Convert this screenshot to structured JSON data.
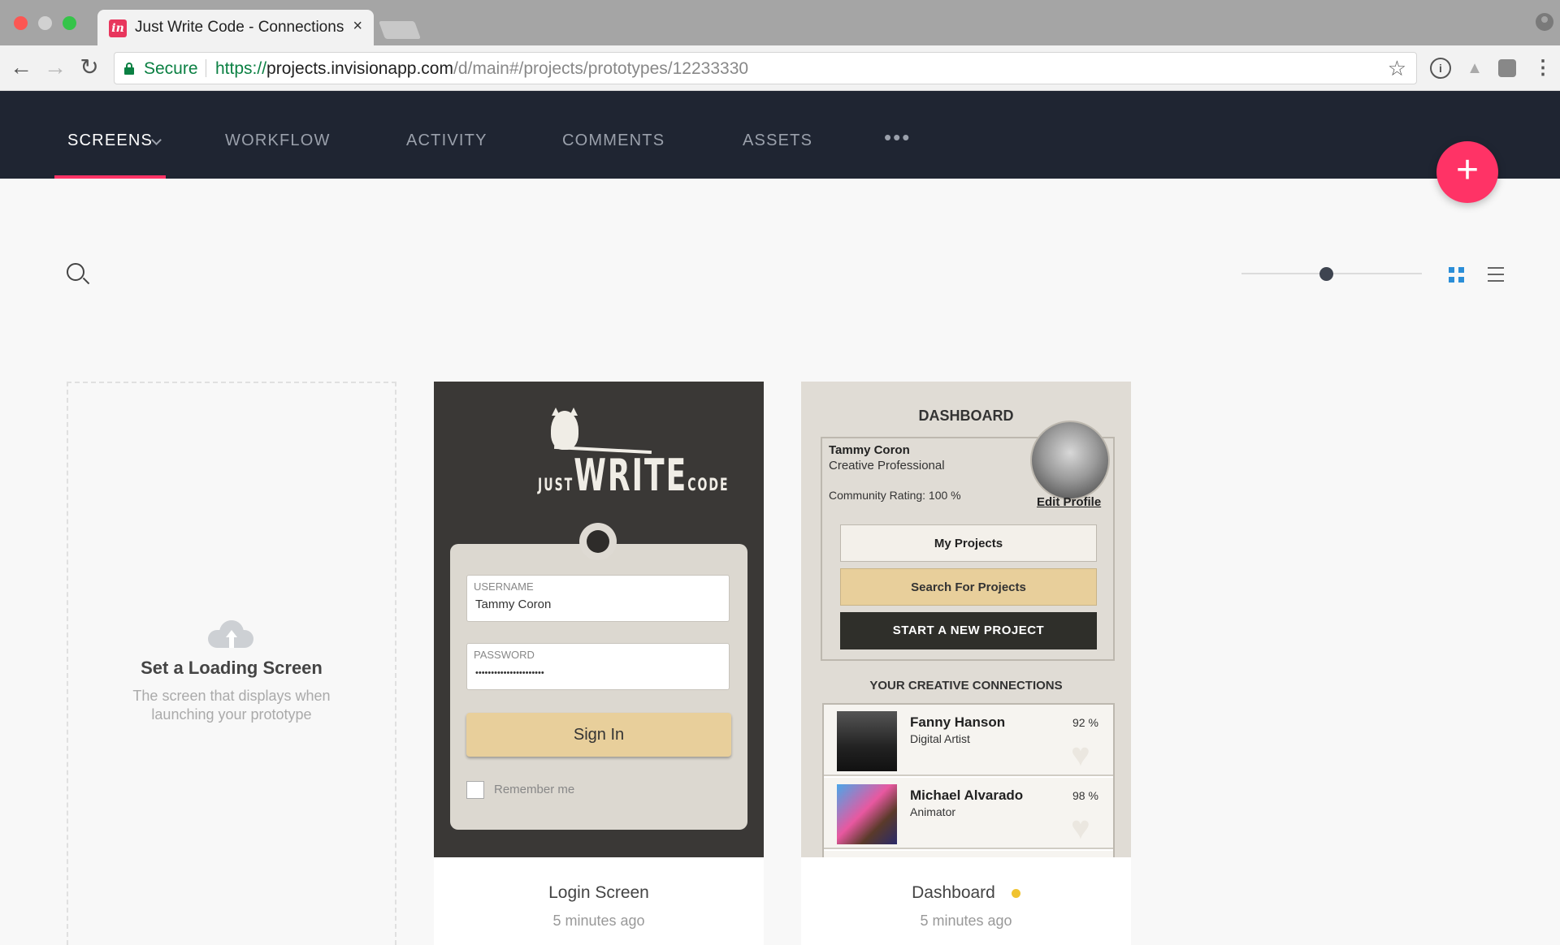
{
  "browser": {
    "tab_title": "Just Write Code - Connections",
    "tab_close": "×",
    "favicon": "in",
    "secure_label": "Secure",
    "url_protocol": "https://",
    "url_host": "projects.invisionapp.com",
    "url_path": "/d/main#/projects/prototypes/12233330"
  },
  "nav": {
    "tabs": [
      {
        "label": "SCREENS",
        "active": true
      },
      {
        "label": "WORKFLOW"
      },
      {
        "label": "ACTIVITY"
      },
      {
        "label": "COMMENTS"
      },
      {
        "label": "ASSETS"
      }
    ],
    "more": "•••",
    "add": "+"
  },
  "accent": "#ff3366",
  "loading_card": {
    "title": "Set a Loading Screen",
    "subtitle": "The screen that displays when launching your prototype"
  },
  "cards": [
    {
      "title": "Login Screen",
      "time": "5 minutes ago",
      "login": {
        "logo_just": "JUST",
        "logo_write": "WRITE",
        "logo_code": "CODE",
        "username_label": "USERNAME",
        "username_value": "Tammy Coron",
        "password_label": "PASSWORD",
        "password_value": "••••••••••••••••••••••",
        "signin": "Sign In",
        "remember": "Remember me"
      }
    },
    {
      "title": "Dashboard",
      "time": "5 minutes ago",
      "dashboard": {
        "heading": "DASHBOARD",
        "name": "Tammy Coron",
        "role": "Creative Professional",
        "rating": "Community Rating: 100 %",
        "edit": "Edit Profile",
        "btn_projects": "My Projects",
        "btn_search": "Search For Projects",
        "btn_start": "START A NEW PROJECT",
        "connections_title": "YOUR CREATIVE CONNECTIONS",
        "connections": [
          {
            "name": "Fanny Hanson",
            "role": "Digital Artist",
            "pct": "92 %"
          },
          {
            "name": "Michael Alvarado",
            "role": "Animator",
            "pct": "98 %"
          }
        ]
      }
    }
  ]
}
